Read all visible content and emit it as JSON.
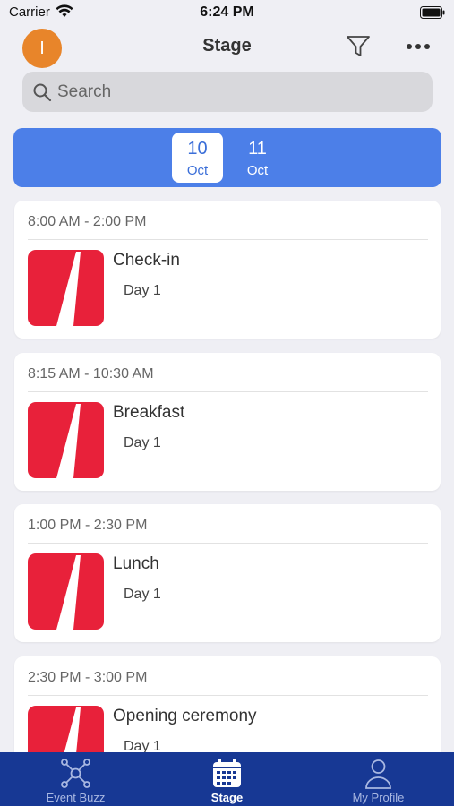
{
  "status_bar": {
    "carrier": "Carrier",
    "time": "6:24 PM"
  },
  "nav": {
    "avatar_initial": "I",
    "title": "Stage",
    "avatar_color": "#e8852a"
  },
  "search": {
    "placeholder": "Search"
  },
  "dates": [
    {
      "day": "10",
      "month": "Oct",
      "selected": true
    },
    {
      "day": "11",
      "month": "Oct",
      "selected": false
    }
  ],
  "sessions": [
    {
      "time": "8:00 AM - 2:00 PM",
      "title": "Check-in",
      "day": "Day 1"
    },
    {
      "time": "8:15 AM - 10:30 AM",
      "title": "Breakfast",
      "day": "Day 1"
    },
    {
      "time": "1:00 PM - 2:30 PM",
      "title": "Lunch",
      "day": "Day 1"
    },
    {
      "time": "2:30 PM - 3:00 PM",
      "title": "Opening ceremony",
      "day": "Day 1"
    }
  ],
  "tab_bar": {
    "items": [
      {
        "label": "Event Buzz",
        "icon": "network-icon",
        "active": false
      },
      {
        "label": "Stage",
        "icon": "calendar-icon",
        "active": true
      },
      {
        "label": "My Profile",
        "icon": "person-icon",
        "active": false
      }
    ]
  },
  "colors": {
    "accent": "#4c7fe8",
    "tab_bar": "#173894",
    "logo_red": "#e8213a",
    "avatar": "#e8852a"
  }
}
